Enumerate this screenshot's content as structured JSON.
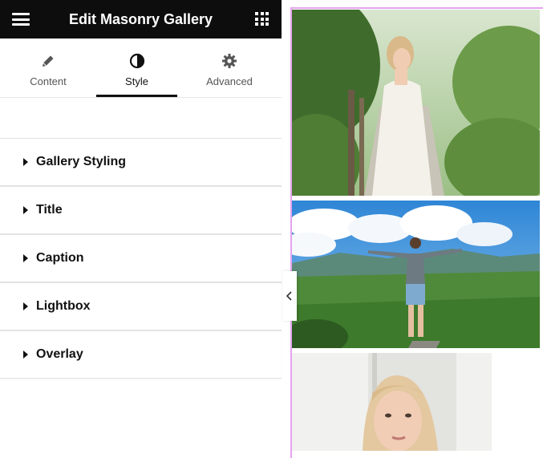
{
  "header": {
    "title": "Edit Masonry Gallery"
  },
  "tabs": [
    {
      "label": "Content",
      "icon": "pencil-icon"
    },
    {
      "label": "Style",
      "icon": "contrast-icon",
      "active": true
    },
    {
      "label": "Advanced",
      "icon": "gear-icon"
    }
  ],
  "sections": [
    {
      "label": "Gallery Styling"
    },
    {
      "label": "Title"
    },
    {
      "label": "Caption"
    },
    {
      "label": "Lightbox"
    },
    {
      "label": "Overlay"
    }
  ],
  "colors": {
    "topbar": "#0d0d0d",
    "accent_border": "#e6a3ef"
  },
  "gallery": {
    "images": [
      {
        "subject": "woman in white dress on garden path"
      },
      {
        "subject": "man with outstretched arms on mountain"
      },
      {
        "subject": "portrait of blonde woman"
      }
    ]
  }
}
